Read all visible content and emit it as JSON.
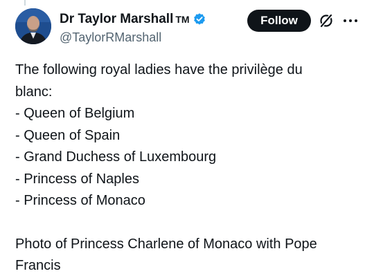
{
  "author": {
    "display_name": "Dr Taylor Marshall",
    "trademark": "TM",
    "handle": "@TaylorRMarshall",
    "verified_icon": "verified-badge-icon",
    "verified_color": "#1d9bf0"
  },
  "actions": {
    "follow_label": "Follow",
    "grok_icon": "grok-icon",
    "more_icon": "more-options-icon"
  },
  "tweet": {
    "lines": [
      "The following royal ladies have the privilège du",
      "blanc:",
      "- Queen of Belgium",
      "- Queen of Spain",
      "- Grand Duchess of Luxembourg",
      "- Princess of Naples",
      "- Princess of Monaco"
    ],
    "caption_lines": [
      "Photo of Princess Charlene of Monaco with Pope",
      "Francis"
    ]
  },
  "colors": {
    "text": "#0f1419",
    "secondary_text": "#536471",
    "follow_button_bg": "#0f1419",
    "follow_button_text": "#ffffff"
  }
}
